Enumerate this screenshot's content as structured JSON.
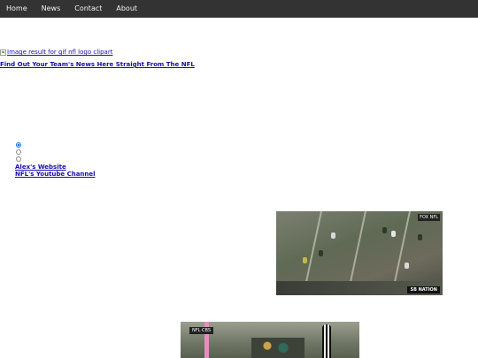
{
  "nav": {
    "items": [
      {
        "label": "Home"
      },
      {
        "label": "News"
      },
      {
        "label": "Contact"
      },
      {
        "label": "About"
      }
    ]
  },
  "logo": {
    "alt_text": "Image result for gif nfl logo clipart"
  },
  "headline": "Find Out Your Team's News Here Straight From The NFL",
  "radios": {
    "states": [
      "checked",
      "unchecked",
      "unchecked"
    ]
  },
  "links": [
    {
      "label": "Alex's Website"
    },
    {
      "label": "NFL's Youtube Channel"
    }
  ],
  "gif1": {
    "top_badge": "FOX NFL",
    "bottom_badge": "SB NATION"
  },
  "gif2": {
    "badge": "NFL CBS"
  },
  "colors": {
    "nav_bg": "#333333",
    "nav_text": "#f2f2f2",
    "link": "#1a0dab"
  }
}
